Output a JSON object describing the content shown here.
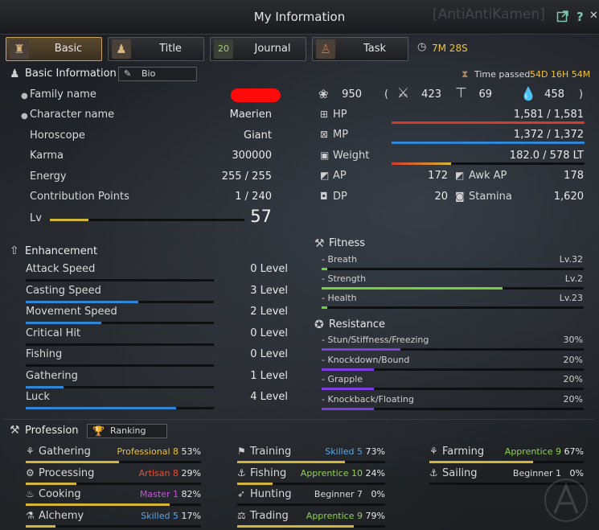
{
  "window": {
    "title": "My Information",
    "ghost_text": "[AntiAntiKamen]",
    "external_icon": "external-link-icon",
    "help_label": "?",
    "close_label": "✕"
  },
  "tabs": [
    {
      "label": "Basic",
      "icon": "character-icon",
      "active": true
    },
    {
      "label": "Title",
      "icon": "title-icon",
      "active": false
    },
    {
      "label": "Journal",
      "icon": "calendar-icon",
      "calendar_day": "20",
      "active": false
    },
    {
      "label": "Task",
      "icon": "task-icon",
      "active": false
    }
  ],
  "timer": "7M 28S",
  "basic": {
    "header": "Basic Information",
    "bio_label": "Bio",
    "time_passed_label": "Time passed:",
    "time_passed_value": "54D 16H 54M",
    "rows": [
      {
        "label": "Family name",
        "value": "",
        "redacted": true,
        "bullet": true
      },
      {
        "label": "Character name",
        "value": "Maerien",
        "bullet": true
      },
      {
        "label": "Horoscope",
        "value": "Giant"
      },
      {
        "label": "Karma",
        "value": "300000"
      },
      {
        "label": "Energy",
        "value": "255 / 255"
      },
      {
        "label": "Contribution Points",
        "value": "1 / 240"
      }
    ],
    "lv_label": "Lv",
    "lv_value": "57",
    "lv_progress": 0.2
  },
  "stats": {
    "gs_total": "950",
    "open_paren": "(",
    "close_paren": ")",
    "ap_total": "423",
    "awk_total": "69",
    "dp_total": "458",
    "hp_label": "HP",
    "hp_value": "1,581 / 1,581",
    "hp_fraction": 1.0,
    "mp_label": "MP",
    "mp_value": "1,372 / 1,372",
    "mp_fraction": 1.0,
    "weight_label": "Weight",
    "weight_value": "182.0 / 578 LT",
    "weight_fraction": 0.31,
    "ap_label": "AP",
    "ap_value": "172",
    "awk_ap_label": "Awk AP",
    "awk_ap_value": "178",
    "dp_label": "DP",
    "dp_value": "20",
    "stamina_label": "Stamina",
    "stamina_value": "1,620",
    "colors": {
      "hp": "#d63a2c",
      "mp": "#2f86d6",
      "weight": "#d4b53a"
    }
  },
  "enhancement": {
    "header": "Enhancement",
    "items": [
      {
        "label": "Attack Speed",
        "value": "0 Level",
        "fraction": 0.0
      },
      {
        "label": "Casting Speed",
        "value": "3 Level",
        "fraction": 0.6
      },
      {
        "label": "Movement Speed",
        "value": "2 Level",
        "fraction": 0.4
      },
      {
        "label": "Critical Hit",
        "value": "0 Level",
        "fraction": 0.0
      },
      {
        "label": "Fishing",
        "value": "0 Level",
        "fraction": 0.0
      },
      {
        "label": "Gathering",
        "value": "1 Level",
        "fraction": 0.2
      },
      {
        "label": "Luck",
        "value": "4 Level",
        "fraction": 0.8
      }
    ]
  },
  "fitness": {
    "header": "Fitness",
    "items": [
      {
        "label": "- Breath",
        "value": "Lv.32",
        "fraction": 0.02
      },
      {
        "label": "- Strength",
        "value": "Lv.2",
        "fraction": 0.69
      },
      {
        "label": "- Health",
        "value": "Lv.23",
        "fraction": 0.02
      }
    ]
  },
  "resistance": {
    "header": "Resistance",
    "items": [
      {
        "label": "- Stun/Stiffness/Freezing",
        "value": "30%",
        "fraction": 0.3
      },
      {
        "label": "- Knockdown/Bound",
        "value": "20%",
        "fraction": 0.2
      },
      {
        "label": "- Grapple",
        "value": "20%",
        "fraction": 0.2
      },
      {
        "label": "- Knockback/Floating",
        "value": "20%",
        "fraction": 0.2
      }
    ]
  },
  "profession": {
    "header": "Profession",
    "ranking_label": "Ranking",
    "items": [
      {
        "label": "Gathering",
        "rank": "Professional 8",
        "pct": "53%",
        "rank_color": "#f0c23a",
        "fraction": 0.53
      },
      {
        "label": "Training",
        "rank": "Skilled 5",
        "pct": "73%",
        "rank_color": "#5aa6e6",
        "fraction": 0.73
      },
      {
        "label": "Farming",
        "rank": "Apprentice 9",
        "pct": "67%",
        "rank_color": "#8fd14f",
        "fraction": 0.67
      },
      {
        "label": "Processing",
        "rank": "Artisan 8",
        "pct": "29%",
        "rank_color": "#e0533a",
        "fraction": 0.29
      },
      {
        "label": "Fishing",
        "rank": "Apprentice 10",
        "pct": "24%",
        "rank_color": "#8fd14f",
        "fraction": 0.24
      },
      {
        "label": "Sailing",
        "rank": "Beginner 1",
        "pct": "0%",
        "rank_color": "#d8d8d8",
        "fraction": 0.0
      },
      {
        "label": "Cooking",
        "rank": "Master 1",
        "pct": "82%",
        "rank_color": "#c455d8",
        "fraction": 0.82
      },
      {
        "label": "Hunting",
        "rank": "Beginner 7",
        "pct": "0%",
        "rank_color": "#d8d8d8",
        "fraction": 0.0
      },
      {
        "label": "Alchemy",
        "rank": "Skilled 5",
        "pct": "17%",
        "rank_color": "#5aa6e6",
        "fraction": 0.17
      },
      {
        "label": "Trading",
        "rank": "Apprentice 9",
        "pct": "79%",
        "rank_color": "#8fd14f",
        "fraction": 0.79
      }
    ]
  }
}
